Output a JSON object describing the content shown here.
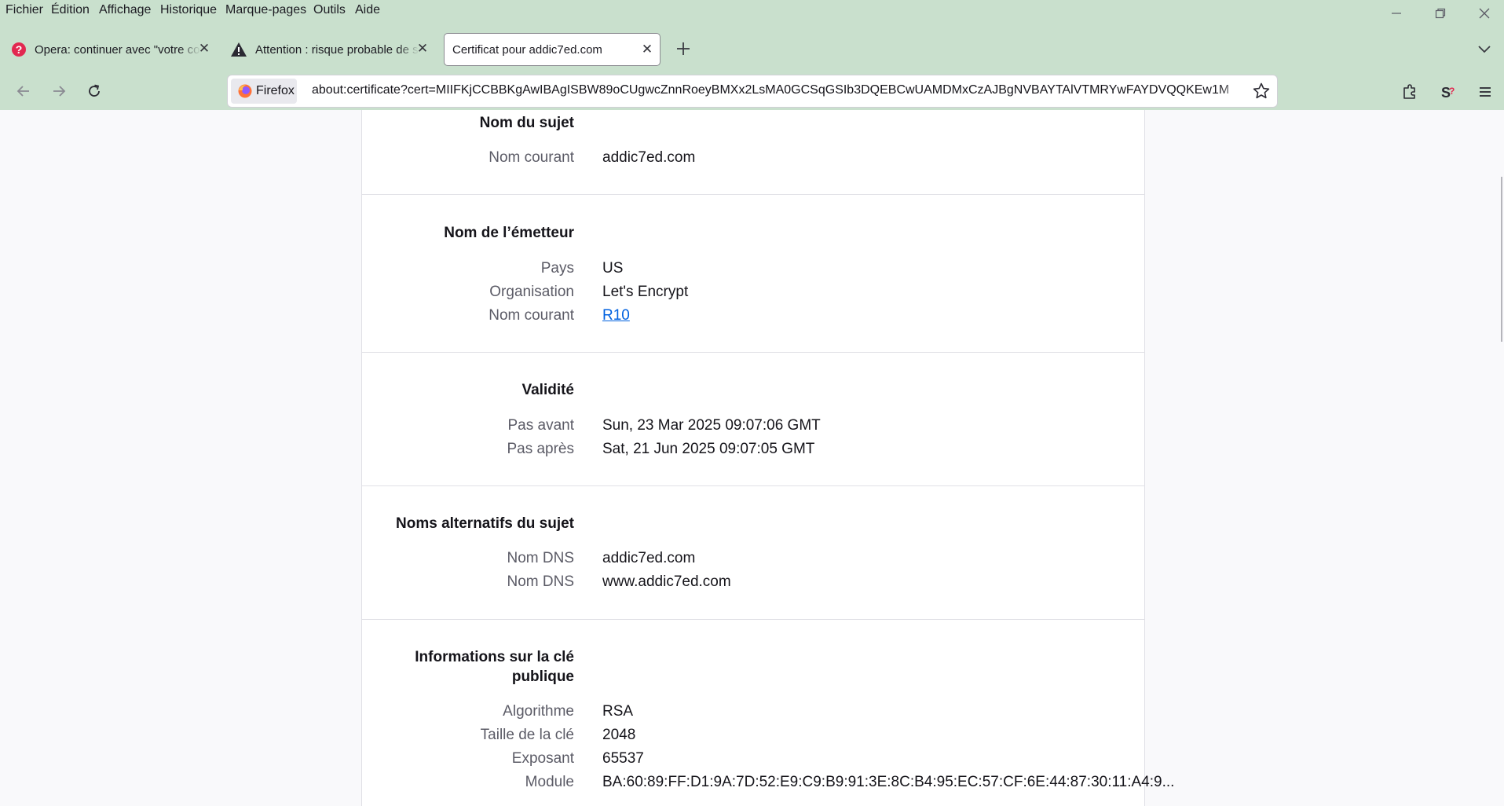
{
  "menubar": {
    "items": [
      "Fichier",
      "Édition",
      "Affichage",
      "Historique",
      "Marque-pages",
      "Outils",
      "Aide"
    ]
  },
  "tabs": [
    {
      "title": "Opera: continuer avec \"votre co",
      "icon": "question-circle-icon",
      "active": false
    },
    {
      "title": "Attention : risque probable de s",
      "icon": "warning-triangle-icon",
      "active": false
    },
    {
      "title": "Certificat pour addic7ed.com",
      "icon": "",
      "active": true
    }
  ],
  "urlbar": {
    "identity_label": "Firefox",
    "url": "about:certificate?cert=MIIFKjCCBBKgAwIBAgISBW89oCUgwcZnnRoeyBMXx2LsMA0GCSqGSIb3DQEBCwUAMDMxCzAJBgNVBAYTAlVTMRYwFAYDVQQKEw1M"
  },
  "certificate": {
    "subject": {
      "title": "Nom du sujet",
      "rows": [
        {
          "label": "Nom courant",
          "value": "addic7ed.com"
        }
      ]
    },
    "issuer": {
      "title": "Nom de l’émetteur",
      "rows": [
        {
          "label": "Pays",
          "value": "US"
        },
        {
          "label": "Organisation",
          "value": "Let's Encrypt"
        },
        {
          "label": "Nom courant",
          "value": "R10",
          "link": true
        }
      ]
    },
    "validity": {
      "title": "Validité",
      "rows": [
        {
          "label": "Pas avant",
          "value": "Sun, 23 Mar 2025 09:07:06 GMT"
        },
        {
          "label": "Pas après",
          "value": "Sat, 21 Jun 2025 09:07:05 GMT"
        }
      ]
    },
    "san": {
      "title": "Noms alternatifs du sujet",
      "rows": [
        {
          "label": "Nom DNS",
          "value": "addic7ed.com"
        },
        {
          "label": "Nom DNS",
          "value": "www.addic7ed.com"
        }
      ]
    },
    "public_key": {
      "title_line1": "Informations sur la clé",
      "title_line2": "publique",
      "rows": [
        {
          "label": "Algorithme",
          "value": "RSA"
        },
        {
          "label": "Taille de la clé",
          "value": "2048"
        },
        {
          "label": "Exposant",
          "value": "65537"
        },
        {
          "label": "Module",
          "value": "BA:60:89:FF:D1:9A:7D:52:E9:C9:B9:91:3E:8C:B4:95:EC:57:CF:6E:44:87:30:11:A4:9..."
        }
      ]
    }
  },
  "colors": {
    "chrome_bg": "#c9e0cd",
    "link": "#0061e0",
    "label_gray": "#5b5b66"
  }
}
